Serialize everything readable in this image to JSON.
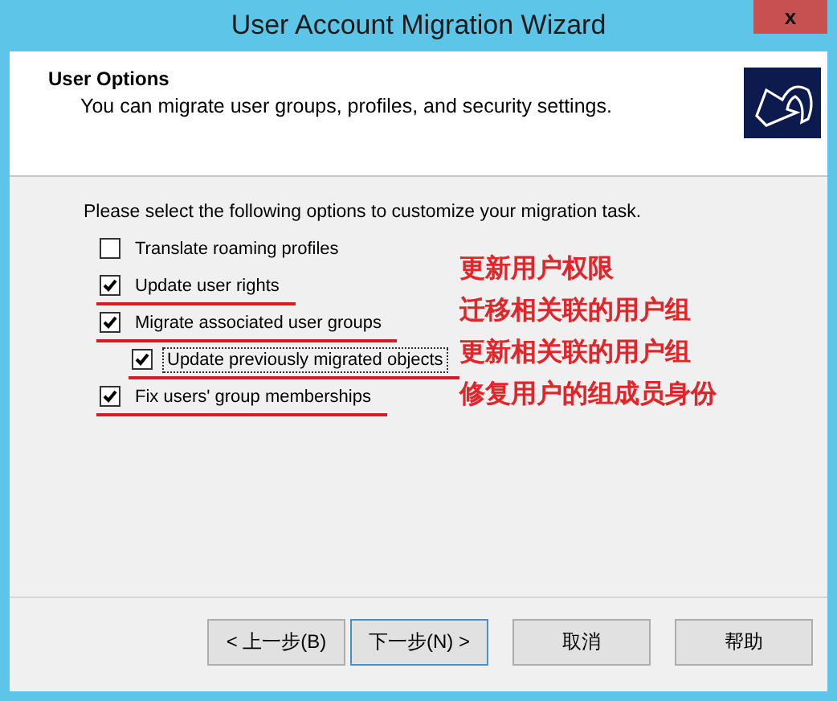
{
  "window": {
    "title": "User Account Migration Wizard",
    "close": "x"
  },
  "header": {
    "title": "User Options",
    "subtitle": "You can migrate user groups, profiles, and security settings."
  },
  "instruction": "Please select the following options to customize your migration task.",
  "options": [
    {
      "label": "Translate roaming profiles",
      "checked": false,
      "focused": false,
      "underlined": false
    },
    {
      "label": "Update user rights",
      "checked": true,
      "focused": false,
      "underlined": true
    },
    {
      "label": "Migrate associated user groups",
      "checked": true,
      "focused": false,
      "underlined": true,
      "children": [
        {
          "label": "Update previously migrated objects",
          "checked": true,
          "focused": true,
          "underlined": true
        }
      ]
    },
    {
      "label": "Fix users' group memberships",
      "checked": true,
      "focused": false,
      "underlined": true
    }
  ],
  "annotations": [
    {
      "text": "更新用户权限",
      "color": "#e0262b"
    },
    {
      "text": "迁移相关联的用户组",
      "color": "#e0262b"
    },
    {
      "text": "更新相关联的用户组",
      "color": "#e0262b"
    },
    {
      "text": "修复用户的组成员身份",
      "color": "#e0262b"
    }
  ],
  "buttons": [
    {
      "label": "< 上一步(B)",
      "default": false
    },
    {
      "label": "下一步(N) >",
      "default": true
    },
    {
      "label": "取消",
      "default": false
    },
    {
      "label": "帮助",
      "default": false
    }
  ]
}
